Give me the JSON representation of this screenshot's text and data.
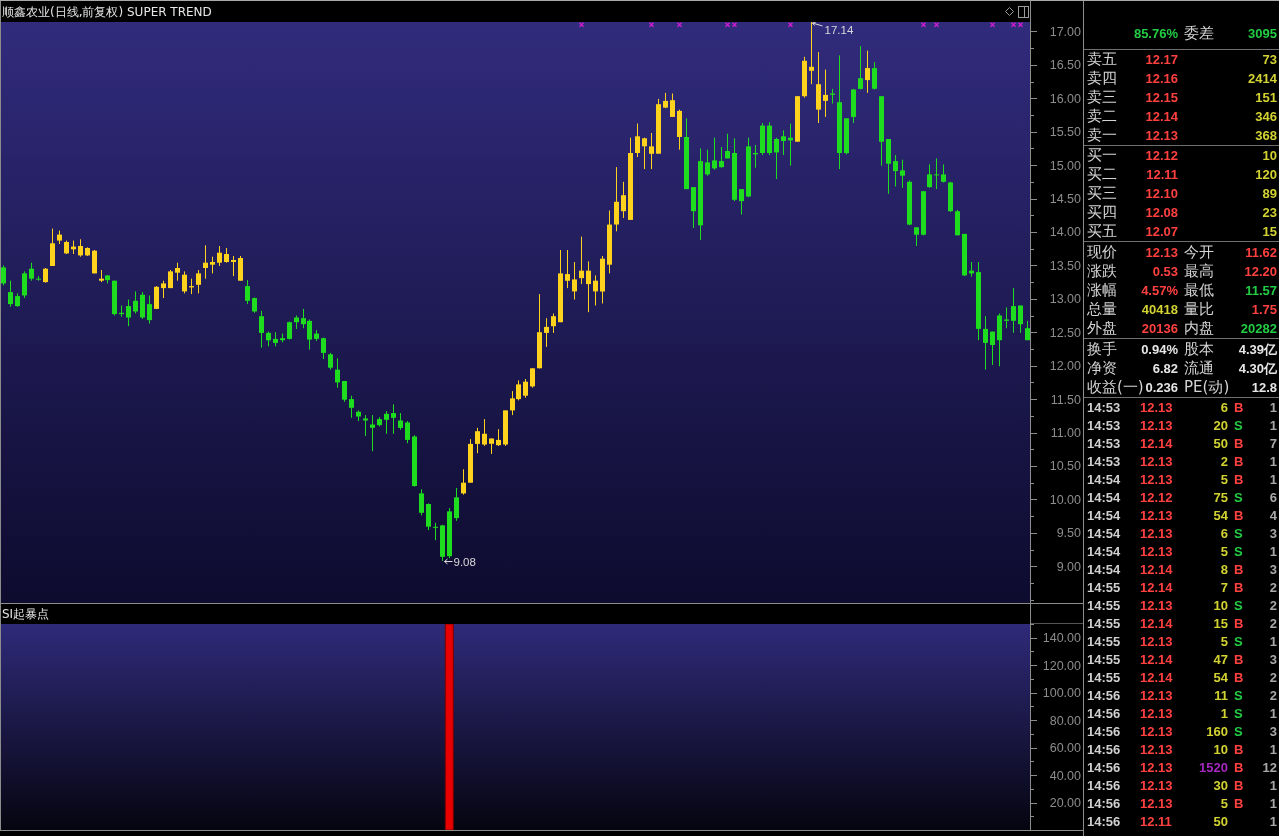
{
  "main_chart": {
    "chart_data": [
      {
        "type": "candlestick",
        "title": "顺鑫农业(日线,前复权) SUPER TREND",
        "ylim": [
          8.45,
          17.14
        ],
        "yticks": [
          {
            "value": 9,
            "label": "9.00"
          },
          {
            "value": 9.5,
            "label": "9.50"
          },
          {
            "value": 10,
            "label": "10.00"
          },
          {
            "value": 10.5,
            "label": "10.50"
          },
          {
            "value": 11,
            "label": "11.00"
          },
          {
            "value": 11.5,
            "label": "11.50"
          },
          {
            "value": 12,
            "label": "12.00"
          },
          {
            "value": 12.5,
            "label": "12.50"
          },
          {
            "value": 13,
            "label": "13.00"
          },
          {
            "value": 13.5,
            "label": "13.50"
          },
          {
            "value": 14,
            "label": "14.00"
          },
          {
            "value": 14.5,
            "label": "14.50"
          },
          {
            "value": 15,
            "label": "15.00"
          },
          {
            "value": 15.5,
            "label": "15.50"
          },
          {
            "value": 16,
            "label": "16.00"
          },
          {
            "value": 16.5,
            "label": "16.50"
          },
          {
            "value": 17,
            "label": "17.00"
          }
        ],
        "annotations": [
          "17.14",
          "9.08"
        ],
        "categories": [
          null,
          null,
          null,
          null,
          null,
          null,
          null,
          null,
          null,
          null,
          null,
          null,
          null,
          null,
          null,
          null,
          null,
          null,
          null,
          null,
          null,
          null,
          null,
          null,
          null,
          null,
          null,
          null,
          null,
          null,
          null,
          null,
          null,
          null,
          null,
          null,
          null,
          null,
          null,
          null,
          null,
          null,
          null,
          null,
          null,
          null,
          null,
          null,
          null,
          null,
          null,
          null,
          null,
          null,
          null,
          null,
          null,
          null,
          null,
          null,
          null,
          null,
          null,
          null,
          null,
          null,
          null,
          null,
          null,
          null,
          null,
          null,
          null,
          null,
          null,
          null,
          null,
          null,
          null,
          null,
          null,
          null,
          null,
          null,
          null,
          null,
          null,
          null,
          null,
          null,
          null,
          null,
          null,
          null,
          null,
          null,
          null,
          null,
          null,
          null,
          null,
          null,
          null,
          null,
          null,
          null,
          null,
          null,
          null,
          null,
          null,
          null,
          null,
          null,
          null,
          null,
          null,
          null,
          null,
          null,
          null,
          null,
          null,
          null,
          null,
          null,
          null,
          null,
          null,
          null,
          null,
          null,
          null,
          null,
          null,
          null,
          null,
          null,
          null,
          null,
          null,
          null,
          null,
          null,
          null,
          null,
          null,
          null
        ],
        "series": [
          {
            "type": "scatter",
            "marker": "cross",
            "color": "#d41cd4",
            "values": [
              null,
              null,
              null,
              null,
              null,
              null,
              null,
              null,
              null,
              null,
              null,
              null,
              null,
              null,
              null,
              null,
              null,
              null,
              null,
              null,
              null,
              null,
              null,
              null,
              null,
              null,
              null,
              null,
              null,
              null,
              null,
              null,
              null,
              null,
              null,
              null,
              null,
              null,
              null,
              null,
              null,
              null,
              null,
              null,
              null,
              null,
              null,
              null,
              null,
              null,
              null,
              null,
              null,
              null,
              null,
              null,
              null,
              null,
              null,
              null,
              null,
              null,
              null,
              null,
              null,
              null,
              null,
              null,
              null,
              null,
              null,
              null,
              null,
              null,
              null,
              null,
              null,
              null,
              null,
              null,
              null,
              null,
              null,
              17.1,
              null,
              null,
              null,
              null,
              null,
              null,
              null,
              null,
              null,
              17.1,
              null,
              null,
              null,
              17.1,
              null,
              null,
              null,
              null,
              null,
              null,
              17.1,
              17.1,
              null,
              null,
              null,
              null,
              null,
              null,
              null,
              17.1,
              null,
              null,
              null,
              null,
              null,
              null,
              null,
              null,
              null,
              null,
              null,
              null,
              null,
              null,
              null,
              null,
              null,
              null,
              17.1,
              null,
              17.1,
              null,
              null,
              null,
              null,
              null,
              null,
              null,
              17.1,
              null,
              null,
              17.1,
              17.1,
              null
            ]
          }
        ],
        "ohlc": [
          [
            13.47,
            13.5,
            13.2,
            13.23
          ],
          [
            13.1,
            13.27,
            12.88,
            12.92
          ],
          [
            13.04,
            13.08,
            12.88,
            12.89
          ],
          [
            13.38,
            13.41,
            13.01,
            13.05
          ],
          [
            13.45,
            13.54,
            13.27,
            13.3
          ],
          [
            13.3,
            13.34,
            13.27,
            13.29
          ],
          [
            13.25,
            13.46,
            13.24,
            13.45
          ],
          [
            13.49,
            14.05,
            13.49,
            13.83
          ],
          [
            13.87,
            14.02,
            13.82,
            13.96
          ],
          [
            13.68,
            13.87,
            13.67,
            13.85
          ],
          [
            13.74,
            13.87,
            13.67,
            13.78
          ],
          [
            13.65,
            13.89,
            13.63,
            13.79
          ],
          [
            13.65,
            13.77,
            13.64,
            13.76
          ],
          [
            13.38,
            13.73,
            13.38,
            13.72
          ],
          [
            13.27,
            13.43,
            13.25,
            13.3
          ],
          [
            13.35,
            13.35,
            13.23,
            13.28
          ],
          [
            13.27,
            13.27,
            12.75,
            12.77
          ],
          [
            12.79,
            12.9,
            12.73,
            12.77
          ],
          [
            12.89,
            12.99,
            12.59,
            12.72
          ],
          [
            12.97,
            13.11,
            12.78,
            12.81
          ],
          [
            13.06,
            13.1,
            12.7,
            12.72
          ],
          [
            12.92,
            13.05,
            12.63,
            12.68
          ],
          [
            12.85,
            13.19,
            12.85,
            13.18
          ],
          [
            13.16,
            13.27,
            13.01,
            13.23
          ],
          [
            13.16,
            13.43,
            13.16,
            13.41
          ],
          [
            13.39,
            13.54,
            13.27,
            13.46
          ],
          [
            13.11,
            13.41,
            13.08,
            13.36
          ],
          [
            13.17,
            13.3,
            13.07,
            13.19
          ],
          [
            13.21,
            13.43,
            13.08,
            13.38
          ],
          [
            13.46,
            13.8,
            13.3,
            13.54
          ],
          [
            13.51,
            13.63,
            13.38,
            13.55
          ],
          [
            13.54,
            13.79,
            13.49,
            13.69
          ],
          [
            13.55,
            13.76,
            13.54,
            13.67
          ],
          [
            13.55,
            13.64,
            13.34,
            13.58
          ],
          [
            13.27,
            13.64,
            13.27,
            13.61
          ],
          [
            13.19,
            13.28,
            12.92,
            12.97
          ],
          [
            13.01,
            13.02,
            12.79,
            12.81
          ],
          [
            12.74,
            12.82,
            12.27,
            12.49
          ],
          [
            12.49,
            12.51,
            12.29,
            12.38
          ],
          [
            12.4,
            12.5,
            12.29,
            12.34
          ],
          [
            12.41,
            12.48,
            12.35,
            12.38
          ],
          [
            12.65,
            12.66,
            12.39,
            12.4
          ],
          [
            12.72,
            12.75,
            12.55,
            12.65
          ],
          [
            12.71,
            12.85,
            12.56,
            12.62
          ],
          [
            12.67,
            12.69,
            12.24,
            12.39
          ],
          [
            12.48,
            12.53,
            12.37,
            12.4
          ],
          [
            12.41,
            12.42,
            12.1,
            12.19
          ],
          [
            12.17,
            12.19,
            11.94,
            11.97
          ],
          [
            11.94,
            12.11,
            11.67,
            11.75
          ],
          [
            11.77,
            11.77,
            11.46,
            11.49
          ],
          [
            11.5,
            11.55,
            11.22,
            11.37
          ],
          [
            11.31,
            11.33,
            11.17,
            11.24
          ],
          [
            11.21,
            11.26,
            10.95,
            11.18
          ],
          [
            11.12,
            11.26,
            10.72,
            11.07
          ],
          [
            11.2,
            11.23,
            11.09,
            11.11
          ],
          [
            11.28,
            11.32,
            10.98,
            11.19
          ],
          [
            11.29,
            11.42,
            10.98,
            11.22
          ],
          [
            11.18,
            11.29,
            11.04,
            11.07
          ],
          [
            11.15,
            11.17,
            10.84,
            10.89
          ],
          [
            10.94,
            10.96,
            10.19,
            10.2
          ],
          [
            10.09,
            10.15,
            9.76,
            9.8
          ],
          [
            9.93,
            9.94,
            9.54,
            9.59
          ],
          [
            9.59,
            9.65,
            9.39,
            9.58
          ],
          [
            9.61,
            9.62,
            9.08,
            9.14
          ],
          [
            9.82,
            9.87,
            9.12,
            9.15
          ],
          [
            10.03,
            10.17,
            9.68,
            9.72
          ],
          [
            10.09,
            10.45,
            10.07,
            10.25
          ],
          [
            10.25,
            10.9,
            10.25,
            10.83
          ],
          [
            10.83,
            11.07,
            10.69,
            11.02
          ],
          [
            10.82,
            11.2,
            10.8,
            10.98
          ],
          [
            10.83,
            10.91,
            10.68,
            10.91
          ],
          [
            10.81,
            11.05,
            10.8,
            10.89
          ],
          [
            10.82,
            11.33,
            10.8,
            11.33
          ],
          [
            11.33,
            11.62,
            11.26,
            11.51
          ],
          [
            11.5,
            11.78,
            11.48,
            11.72
          ],
          [
            11.55,
            11.8,
            11.52,
            11.76
          ],
          [
            11.69,
            11.96,
            11.67,
            11.96
          ],
          [
            11.96,
            13.07,
            11.96,
            12.5
          ],
          [
            12.49,
            12.71,
            12.28,
            12.58
          ],
          [
            12.59,
            12.78,
            12.49,
            12.74
          ],
          [
            12.65,
            13.73,
            12.65,
            13.38
          ],
          [
            13.27,
            13.73,
            13.16,
            13.37
          ],
          [
            13.11,
            13.55,
            12.99,
            13.29
          ],
          [
            13.31,
            13.93,
            13.22,
            13.42
          ],
          [
            13.22,
            13.56,
            12.8,
            13.42
          ],
          [
            13.11,
            13.35,
            12.9,
            13.27
          ],
          [
            13.11,
            13.64,
            12.93,
            13.6
          ],
          [
            13.51,
            14.32,
            13.38,
            14.11
          ],
          [
            14.11,
            14.97,
            14.01,
            14.45
          ],
          [
            14.31,
            14.75,
            14.21,
            14.55
          ],
          [
            14.18,
            15.41,
            14.18,
            15.18
          ],
          [
            15.18,
            15.62,
            15.12,
            15.43
          ],
          [
            15.28,
            15.41,
            14.94,
            15.4
          ],
          [
            15.17,
            15.48,
            14.94,
            15.28
          ],
          [
            15.17,
            15.99,
            15.17,
            15.91
          ],
          [
            15.86,
            16.08,
            15.85,
            15.96
          ],
          [
            15.72,
            16.07,
            15.72,
            15.97
          ],
          [
            15.42,
            15.83,
            15.23,
            15.81
          ],
          [
            15.42,
            15.7,
            14.64,
            14.64
          ],
          [
            14.67,
            14.67,
            14.06,
            14.31
          ],
          [
            15.06,
            15.25,
            13.88,
            14.1
          ],
          [
            15.04,
            15.23,
            14.84,
            14.86
          ],
          [
            15.07,
            15.41,
            14.93,
            14.95
          ],
          [
            15.06,
            15.27,
            14.96,
            14.97
          ],
          [
            15.21,
            15.47,
            15.1,
            15.1
          ],
          [
            15.18,
            15.4,
            14.46,
            14.48
          ],
          [
            14.64,
            14.64,
            14.26,
            14.46
          ],
          [
            15.28,
            15.41,
            14.52,
            14.53
          ],
          [
            15.18,
            15.3,
            14.96,
            15.16
          ],
          [
            15.59,
            15.63,
            15.15,
            15.18
          ],
          [
            15.59,
            15.64,
            15.15,
            15.18
          ],
          [
            15.39,
            15.41,
            14.79,
            15.19
          ],
          [
            15.43,
            15.52,
            15.15,
            15.36
          ],
          [
            15.41,
            15.62,
            14.99,
            15.37
          ],
          [
            15.35,
            16.03,
            15.35,
            16.03
          ],
          [
            16.03,
            16.62,
            16.01,
            16.56
          ],
          [
            16.41,
            17.14,
            16.21,
            16.47
          ],
          [
            15.83,
            16.69,
            15.63,
            16.21
          ],
          [
            15.96,
            16.43,
            15.72,
            16.05
          ],
          [
            16.07,
            16.14,
            15.92,
            16.05
          ],
          [
            15.94,
            16.64,
            14.94,
            15.18
          ],
          [
            15.7,
            15.7,
            15.16,
            15.18
          ],
          [
            16.13,
            16.14,
            15.63,
            15.72
          ],
          [
            16.3,
            16.78,
            16.13,
            16.14
          ],
          [
            16.27,
            16.71,
            16.08,
            16.45
          ],
          [
            16.45,
            16.54,
            16.13,
            16.14
          ],
          [
            16.03,
            16.03,
            14.99,
            15.35
          ],
          [
            15.39,
            15.39,
            14.57,
            15.02
          ],
          [
            15.06,
            15.15,
            14.68,
            14.91
          ],
          [
            14.92,
            15.08,
            14.66,
            14.84
          ],
          [
            14.75,
            14.77,
            14.1,
            14.11
          ],
          [
            14.07,
            14.07,
            13.79,
            13.96
          ],
          [
            14.61,
            14.61,
            13.95,
            13.96
          ],
          [
            14.86,
            15.01,
            14.66,
            14.67
          ],
          [
            14.86,
            15.1,
            14.64,
            14.85
          ],
          [
            14.86,
            15.01,
            14.74,
            14.75
          ],
          [
            14.74,
            14.75,
            14.3,
            14.31
          ],
          [
            14.31,
            14.33,
            13.95,
            13.95
          ],
          [
            13.97,
            13.97,
            13.34,
            13.35
          ],
          [
            13.42,
            13.55,
            13.33,
            13.38
          ],
          [
            13.4,
            13.55,
            12.38,
            12.55
          ],
          [
            12.55,
            12.74,
            11.94,
            12.34
          ],
          [
            12.51,
            12.51,
            12.01,
            12.31
          ],
          [
            12.75,
            12.78,
            11.99,
            12.38
          ],
          [
            12.69,
            12.87,
            12.56,
            12.67
          ],
          [
            12.89,
            13.16,
            12.49,
            12.67
          ],
          [
            12.9,
            12.9,
            12.49,
            12.62
          ],
          [
            12.56,
            12.67,
            12.38,
            12.38
          ]
        ]
      }
    ]
  },
  "indicator_chart": {
    "chart_data": [
      {
        "type": "bar",
        "title": "SI起暴点",
        "ylim": [
          0,
          150
        ],
        "yticks": [
          {
            "value": 20,
            "label": "20.00"
          },
          {
            "value": 40,
            "label": "40.00"
          },
          {
            "value": 60,
            "label": "60.00"
          },
          {
            "value": 80,
            "label": "80.00"
          },
          {
            "value": 100,
            "label": "100.00"
          },
          {
            "value": 120,
            "label": "120.00"
          },
          {
            "value": 140,
            "label": "140.00"
          }
        ],
        "color": "#e80000",
        "categories": [
          null,
          null,
          null,
          null,
          null,
          null,
          null,
          null,
          null,
          null,
          null,
          null,
          null,
          null,
          null,
          null,
          null,
          null,
          null,
          null,
          null,
          null,
          null,
          null,
          null,
          null,
          null,
          null,
          null,
          null,
          null,
          null,
          null,
          null,
          null,
          null,
          null,
          null,
          null,
          null,
          null,
          null,
          null,
          null,
          null,
          null,
          null,
          null,
          null,
          null,
          null,
          null,
          null,
          null,
          null,
          null,
          null,
          null,
          null,
          null,
          null,
          null,
          null,
          null,
          null,
          null,
          null,
          null,
          null,
          null,
          null,
          null,
          null,
          null,
          null,
          null,
          null,
          null,
          null,
          null,
          null,
          null,
          null,
          null,
          null,
          null,
          null,
          null,
          null,
          null,
          null,
          null,
          null,
          null,
          null,
          null,
          null,
          null,
          null,
          null,
          null,
          null,
          null,
          null,
          null,
          null,
          null,
          null,
          null,
          null,
          null,
          null,
          null,
          null,
          null,
          null,
          null,
          null,
          null,
          null,
          null,
          null,
          null,
          null,
          null,
          null,
          null,
          null,
          null,
          null,
          null,
          null,
          null,
          null,
          null,
          null,
          null,
          null,
          null,
          null,
          null,
          null,
          null,
          null,
          null,
          null,
          null,
          null
        ],
        "values": [
          null,
          null,
          null,
          null,
          null,
          null,
          null,
          null,
          null,
          null,
          null,
          null,
          null,
          null,
          null,
          null,
          null,
          null,
          null,
          null,
          null,
          null,
          null,
          null,
          null,
          null,
          null,
          null,
          null,
          null,
          null,
          null,
          null,
          null,
          null,
          null,
          null,
          null,
          null,
          null,
          null,
          null,
          null,
          null,
          null,
          null,
          null,
          null,
          null,
          null,
          null,
          null,
          null,
          null,
          null,
          null,
          null,
          null,
          null,
          null,
          null,
          null,
          null,
          null,
          150,
          null,
          null,
          null,
          null,
          null,
          null,
          null,
          null,
          null,
          null,
          null,
          null,
          null,
          null,
          null,
          null,
          null,
          null,
          null,
          null,
          null,
          null,
          null,
          null,
          null,
          null,
          null,
          null,
          null,
          null,
          null,
          null,
          null,
          null,
          null,
          null,
          null,
          null,
          null,
          null,
          null,
          null,
          null,
          null,
          null,
          null,
          null,
          null,
          null,
          null,
          null,
          null,
          null,
          null,
          null,
          null,
          null,
          null,
          null,
          null,
          null,
          null,
          null,
          null,
          null,
          null,
          null,
          null,
          null,
          null,
          null,
          null,
          null,
          null,
          null,
          null,
          null,
          null,
          null,
          null,
          null,
          null,
          null
        ]
      }
    ]
  },
  "order_book": {
    "summary": {
      "value": "85.76%",
      "diff_label": "委差",
      "diff_value": "3095",
      "color": "#22cc44"
    },
    "asks": [
      {
        "label": "卖五",
        "price": "12.17",
        "volume": "73"
      },
      {
        "label": "卖四",
        "price": "12.16",
        "volume": "2414"
      },
      {
        "label": "卖三",
        "price": "12.15",
        "volume": "151"
      },
      {
        "label": "卖二",
        "price": "12.14",
        "volume": "346"
      },
      {
        "label": "卖一",
        "price": "12.13",
        "volume": "368"
      }
    ],
    "bids": [
      {
        "label": "买一",
        "price": "12.12",
        "volume": "10"
      },
      {
        "label": "买二",
        "price": "12.11",
        "volume": "120"
      },
      {
        "label": "买三",
        "price": "12.10",
        "volume": "89"
      },
      {
        "label": "买四",
        "price": "12.08",
        "volume": "23"
      },
      {
        "label": "买五",
        "price": "12.07",
        "volume": "15"
      }
    ]
  },
  "quote_stats": [
    {
      "label": "现价",
      "value": "12.13",
      "color": "#ff4040"
    },
    {
      "label": "今开",
      "value": "11.62",
      "color": "#ff4040"
    },
    {
      "label": "涨跌",
      "value": "0.53",
      "color": "#ff4040"
    },
    {
      "label": "最高",
      "value": "12.20",
      "color": "#ff4040"
    },
    {
      "label": "涨幅",
      "value": "4.57%",
      "color": "#ff4040"
    },
    {
      "label": "最低",
      "value": "11.57",
      "color": "#22cc44"
    },
    {
      "label": "总量",
      "value": "40418",
      "color": "#d2d232"
    },
    {
      "label": "量比",
      "value": "1.75",
      "color": "#ff4040"
    },
    {
      "label": "外盘",
      "value": "20136",
      "color": "#ff4040"
    },
    {
      "label": "内盘",
      "value": "20282",
      "color": "#22cc44"
    }
  ],
  "fundamentals": [
    {
      "label": "换手",
      "value": "0.94%"
    },
    {
      "label": "股本",
      "value": "4.39亿"
    },
    {
      "label": "净资",
      "value": "6.82"
    },
    {
      "label": "流通",
      "value": "4.30亿"
    },
    {
      "label": "收益(一)",
      "value": "0.236"
    },
    {
      "label": "PE(动)",
      "value": "12.8"
    }
  ],
  "trades": [
    {
      "time": "14:53",
      "price": "12.13",
      "volume": "6",
      "large": false,
      "flag": "B",
      "color": "#ff4040",
      "count": "1"
    },
    {
      "time": "14:53",
      "price": "12.13",
      "volume": "20",
      "large": false,
      "flag": "S",
      "color": "#22cc44",
      "count": "1"
    },
    {
      "time": "14:53",
      "price": "12.14",
      "volume": "50",
      "large": false,
      "flag": "B",
      "color": "#ff4040",
      "count": "7"
    },
    {
      "time": "14:53",
      "price": "12.13",
      "volume": "2",
      "large": false,
      "flag": "B",
      "color": "#ff4040",
      "count": "1"
    },
    {
      "time": "14:54",
      "price": "12.13",
      "volume": "5",
      "large": false,
      "flag": "B",
      "color": "#ff4040",
      "count": "1"
    },
    {
      "time": "14:54",
      "price": "12.12",
      "volume": "75",
      "large": false,
      "flag": "S",
      "color": "#22cc44",
      "count": "6"
    },
    {
      "time": "14:54",
      "price": "12.13",
      "volume": "54",
      "large": false,
      "flag": "B",
      "color": "#ff4040",
      "count": "4"
    },
    {
      "time": "14:54",
      "price": "12.13",
      "volume": "6",
      "large": false,
      "flag": "S",
      "color": "#22cc44",
      "count": "3"
    },
    {
      "time": "14:54",
      "price": "12.13",
      "volume": "5",
      "large": false,
      "flag": "S",
      "color": "#22cc44",
      "count": "1"
    },
    {
      "time": "14:54",
      "price": "12.14",
      "volume": "8",
      "large": false,
      "flag": "B",
      "color": "#ff4040",
      "count": "3"
    },
    {
      "time": "14:55",
      "price": "12.14",
      "volume": "7",
      "large": false,
      "flag": "B",
      "color": "#ff4040",
      "count": "2"
    },
    {
      "time": "14:55",
      "price": "12.13",
      "volume": "10",
      "large": false,
      "flag": "S",
      "color": "#22cc44",
      "count": "2"
    },
    {
      "time": "14:55",
      "price": "12.14",
      "volume": "15",
      "large": false,
      "flag": "B",
      "color": "#ff4040",
      "count": "2"
    },
    {
      "time": "14:55",
      "price": "12.13",
      "volume": "5",
      "large": false,
      "flag": "S",
      "color": "#22cc44",
      "count": "1"
    },
    {
      "time": "14:55",
      "price": "12.14",
      "volume": "47",
      "large": false,
      "flag": "B",
      "color": "#ff4040",
      "count": "3"
    },
    {
      "time": "14:55",
      "price": "12.14",
      "volume": "54",
      "large": false,
      "flag": "B",
      "color": "#ff4040",
      "count": "2"
    },
    {
      "time": "14:56",
      "price": "12.13",
      "volume": "11",
      "large": false,
      "flag": "S",
      "color": "#22cc44",
      "count": "2"
    },
    {
      "time": "14:56",
      "price": "12.13",
      "volume": "1",
      "large": false,
      "flag": "S",
      "color": "#22cc44",
      "count": "1"
    },
    {
      "time": "14:56",
      "price": "12.13",
      "volume": "160",
      "large": false,
      "flag": "S",
      "color": "#22cc44",
      "count": "3"
    },
    {
      "time": "14:56",
      "price": "12.13",
      "volume": "10",
      "large": false,
      "flag": "B",
      "color": "#ff4040",
      "count": "1"
    },
    {
      "time": "14:56",
      "price": "12.13",
      "volume": "1520",
      "large": true,
      "flag": "B",
      "color": "#ff4040",
      "count": "12"
    },
    {
      "time": "14:56",
      "price": "12.13",
      "volume": "30",
      "large": false,
      "flag": "B",
      "color": "#ff4040",
      "count": "1"
    },
    {
      "time": "14:56",
      "price": "12.13",
      "volume": "5",
      "large": false,
      "flag": "B",
      "color": "#ff4040",
      "count": "1"
    },
    {
      "time": "14:56",
      "price": "12.11",
      "volume": "50",
      "large": false,
      "count": "1"
    }
  ]
}
